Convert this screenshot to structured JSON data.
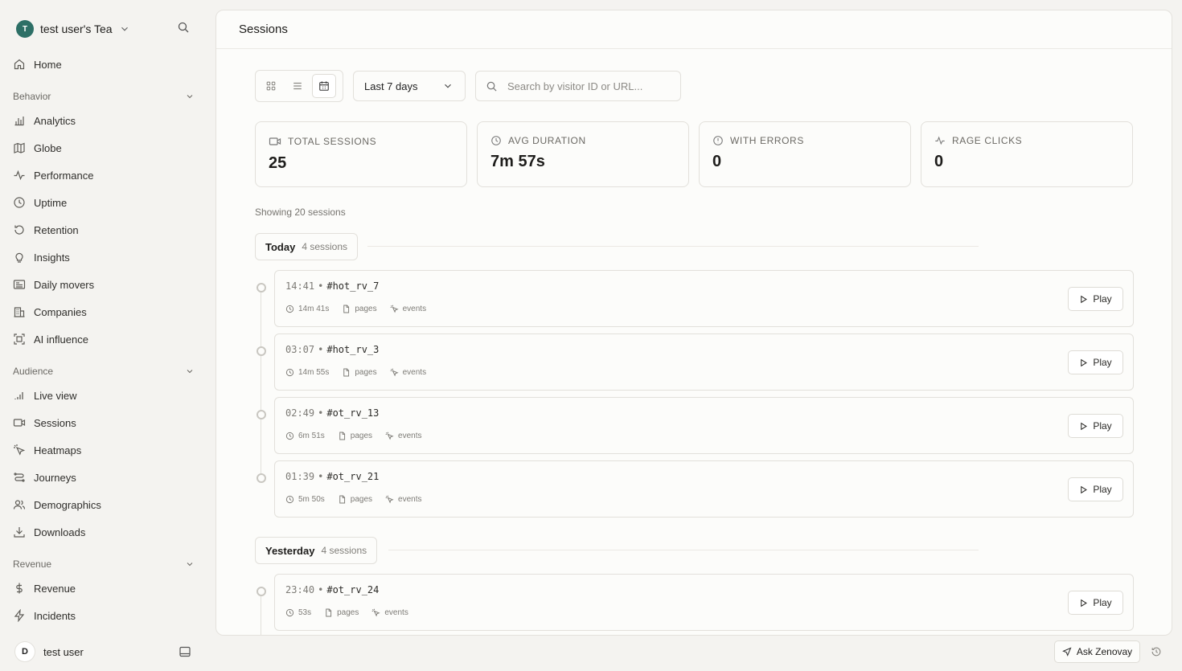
{
  "workspace": {
    "avatar_letter": "T",
    "name": "test user's Tea"
  },
  "nav": {
    "home": "Home",
    "behavior_title": "Behavior",
    "behavior": [
      "Analytics",
      "Globe",
      "Performance",
      "Uptime",
      "Retention",
      "Insights",
      "Daily movers",
      "Companies",
      "AI influence"
    ],
    "audience_title": "Audience",
    "audience": [
      "Live view",
      "Sessions",
      "Heatmaps",
      "Journeys",
      "Demographics",
      "Downloads"
    ],
    "revenue_title": "Revenue",
    "revenue": [
      "Revenue",
      "Incidents"
    ]
  },
  "user": {
    "avatar_letter": "D",
    "name": "test user"
  },
  "header": {
    "title": "Sessions"
  },
  "toolbar": {
    "date_range": "Last 7 days",
    "search_placeholder": "Search by visitor ID or URL..."
  },
  "stats": [
    {
      "label": "TOTAL SESSIONS",
      "value": "25",
      "icon": "video-icon"
    },
    {
      "label": "AVG DURATION",
      "value": "7m 57s",
      "icon": "clock-icon"
    },
    {
      "label": "WITH ERRORS",
      "value": "0",
      "icon": "alert-circle-icon"
    },
    {
      "label": "RAGE CLICKS",
      "value": "0",
      "icon": "activity-icon"
    }
  ],
  "showing_text": "Showing 20 sessions",
  "groups": [
    {
      "title": "Today",
      "count": "4 sessions",
      "sessions": [
        {
          "time": "14:41",
          "id": "#hot_rv_7",
          "duration": "14m 41s",
          "pages": "pages",
          "events": "events",
          "play": "Play"
        },
        {
          "time": "03:07",
          "id": "#hot_rv_3",
          "duration": "14m 55s",
          "pages": "pages",
          "events": "events",
          "play": "Play"
        },
        {
          "time": "02:49",
          "id": "#ot_rv_13",
          "duration": "6m 51s",
          "pages": "pages",
          "events": "events",
          "play": "Play"
        },
        {
          "time": "01:39",
          "id": "#ot_rv_21",
          "duration": "5m 50s",
          "pages": "pages",
          "events": "events",
          "play": "Play"
        }
      ]
    },
    {
      "title": "Yesterday",
      "count": "4 sessions",
      "sessions": [
        {
          "time": "23:40",
          "id": "#ot_rv_24",
          "duration": "53s",
          "pages": "pages",
          "events": "events",
          "play": "Play"
        }
      ]
    }
  ],
  "session_separator": "•",
  "ask_button": "Ask Zenovay",
  "colors": {
    "accent": "#2d6f66",
    "background": "#f4f3f0",
    "panel": "#fcfcfa",
    "border": "#e2e0db"
  }
}
